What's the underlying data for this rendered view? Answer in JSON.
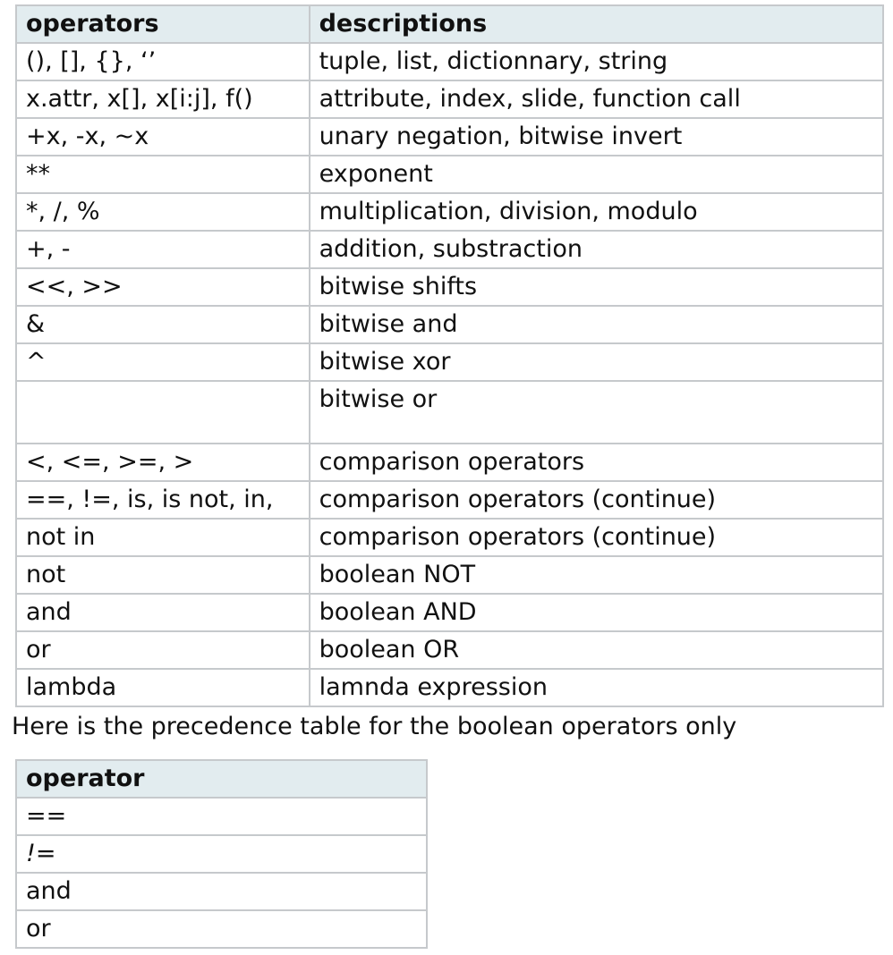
{
  "precedence_table": {
    "headers": [
      "operators",
      "descriptions"
    ],
    "rows": [
      [
        "(), [], {}, ‘’",
        "tuple, list, dictionnary, string"
      ],
      [
        "x.attr, x[], x[i:j], f()",
        "attribute, index, slide, function call"
      ],
      [
        "+x, -x, ~x",
        "unary negation, bitwise invert"
      ],
      [
        "**",
        "exponent"
      ],
      [
        "*, /, %",
        "multiplication, division, modulo"
      ],
      [
        "+, -",
        "addition, substraction"
      ],
      [
        "<<, >>",
        "bitwise shifts"
      ],
      [
        "&",
        "bitwise and"
      ],
      [
        "^",
        "bitwise xor"
      ],
      [
        "",
        "bitwise or"
      ],
      [
        "<, <=, >=, >",
        "comparison operators"
      ],
      [
        "==, !=, is, is not, in,",
        "comparison operators (continue)"
      ],
      [
        "not in",
        "comparison operators (continue)"
      ],
      [
        "not",
        "boolean NOT"
      ],
      [
        "and",
        "boolean AND"
      ],
      [
        "or",
        "boolean OR"
      ],
      [
        "lambda",
        "lamnda expression"
      ]
    ]
  },
  "caption": "Here is the precedence table for the boolean operators only",
  "boolean_table": {
    "header": "operator",
    "rows": [
      "==",
      "!=",
      "and",
      "or"
    ]
  },
  "colors": {
    "header_bg": "#e2ecef",
    "border": "#c6c9cc"
  }
}
